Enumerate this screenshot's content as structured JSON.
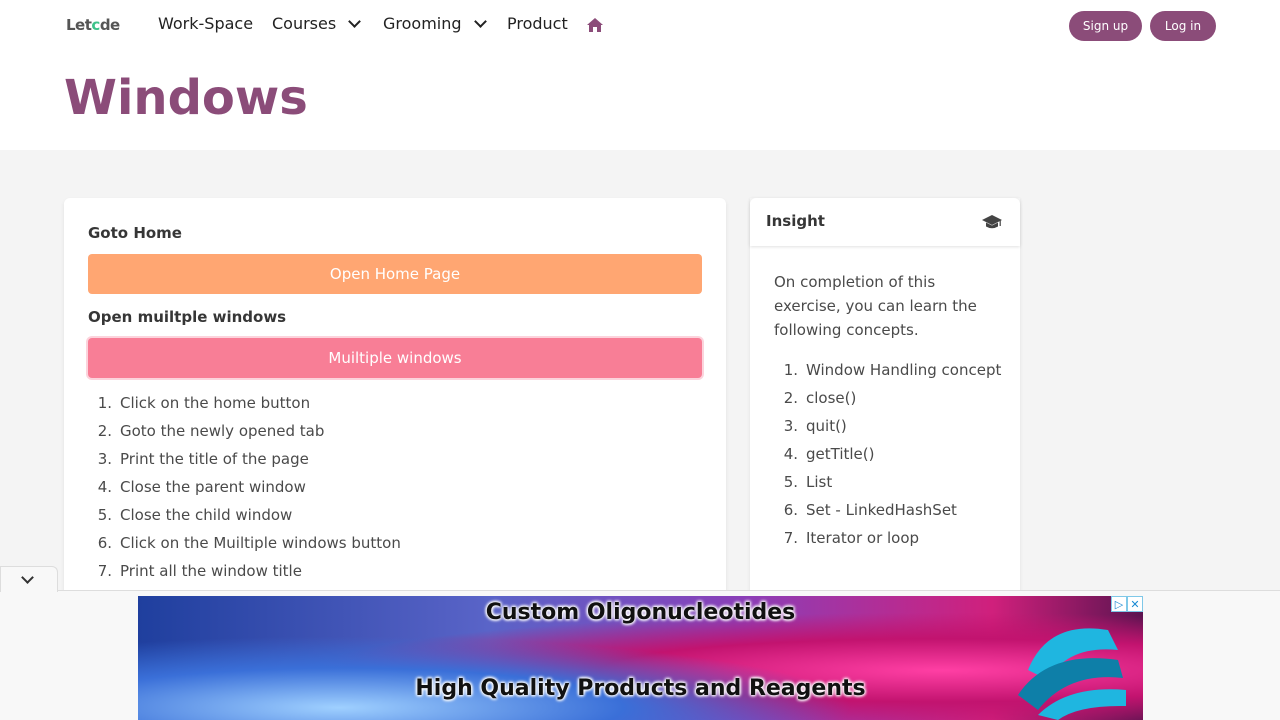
{
  "nav": {
    "logo_prefix": "Let",
    "logo_mid": "c",
    "logo_suffix": "de",
    "items": [
      {
        "label": "Work-Space"
      },
      {
        "label": "Courses"
      },
      {
        "label": "Grooming"
      },
      {
        "label": "Product"
      }
    ],
    "signup": "Sign up",
    "login": "Log in"
  },
  "page": {
    "title": "Windows"
  },
  "main": {
    "goto_home_label": "Goto Home",
    "open_home_button": "Open Home Page",
    "multi_label": "Open muiltple windows",
    "multi_button": "Muiltiple windows",
    "steps": [
      "Click on the home button",
      "Goto the newly opened tab",
      "Print the title of the page",
      "Close the parent window",
      "Close the child window",
      "Click on the Muiltiple windows button",
      "Print all the window title"
    ]
  },
  "insight": {
    "title": "Insight",
    "text": "On completion of this exercise, you can learn the following concepts.",
    "concepts": [
      "Window Handling concept",
      "close()",
      "quit()",
      "getTitle()",
      "List",
      "Set - LinkedHashSet",
      "Iterator or loop"
    ]
  },
  "ad": {
    "line1": "Custom Oligonucleotides",
    "line2": "High Quality Products and Reagents"
  },
  "colors": {
    "brand": "#8b4c79",
    "open_home_btn": "#ffa672",
    "multi_btn": "#f87e96"
  },
  "icons": [
    "chevron-down-icon",
    "home-icon",
    "graduation-cap-icon",
    "adchoices-icon",
    "close-icon"
  ]
}
